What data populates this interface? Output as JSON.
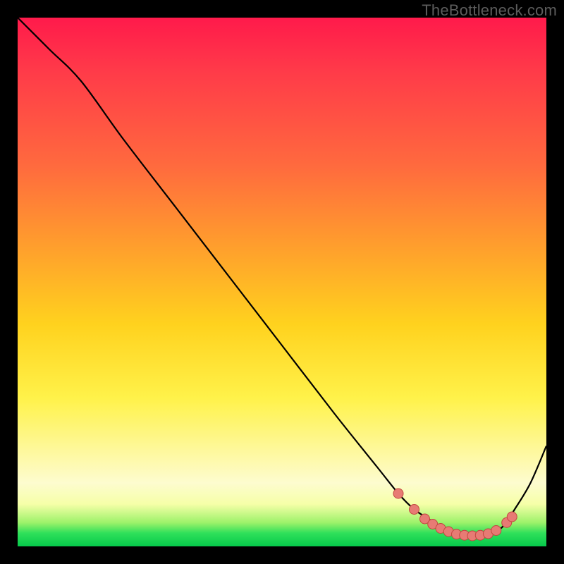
{
  "attribution": "TheBottleneck.com",
  "colors": {
    "page_bg": "#000000",
    "curve_stroke": "#000000",
    "marker_fill": "#e77b74",
    "marker_stroke": "#c2463f"
  },
  "chart_data": {
    "type": "line",
    "title": "",
    "xlabel": "",
    "ylabel": "",
    "xlim": [
      0,
      100
    ],
    "ylim": [
      0,
      100
    ],
    "grid": false,
    "series": [
      {
        "name": "bottleneck-curve",
        "x": [
          0,
          6,
          12,
          20,
          30,
          40,
          50,
          60,
          68,
          72,
          75,
          78,
          80,
          82,
          84,
          86,
          88,
          90,
          92,
          94,
          97,
          100
        ],
        "y": [
          100,
          94,
          88,
          77,
          64,
          51,
          38,
          25,
          15,
          10,
          7,
          5,
          3.5,
          2.5,
          2,
          2,
          2,
          2.5,
          4,
          7,
          12,
          19
        ]
      }
    ],
    "markers": {
      "series": "bottleneck-curve",
      "points": [
        {
          "x": 72,
          "y": 10
        },
        {
          "x": 75,
          "y": 7
        },
        {
          "x": 77,
          "y": 5.2
        },
        {
          "x": 78.5,
          "y": 4.2
        },
        {
          "x": 80,
          "y": 3.4
        },
        {
          "x": 81.5,
          "y": 2.8
        },
        {
          "x": 83,
          "y": 2.3
        },
        {
          "x": 84.5,
          "y": 2.1
        },
        {
          "x": 86,
          "y": 2.0
        },
        {
          "x": 87.5,
          "y": 2.1
        },
        {
          "x": 89,
          "y": 2.4
        },
        {
          "x": 90.5,
          "y": 3.0
        },
        {
          "x": 92.5,
          "y": 4.5
        },
        {
          "x": 93.5,
          "y": 5.6
        }
      ],
      "radius": 7
    }
  }
}
